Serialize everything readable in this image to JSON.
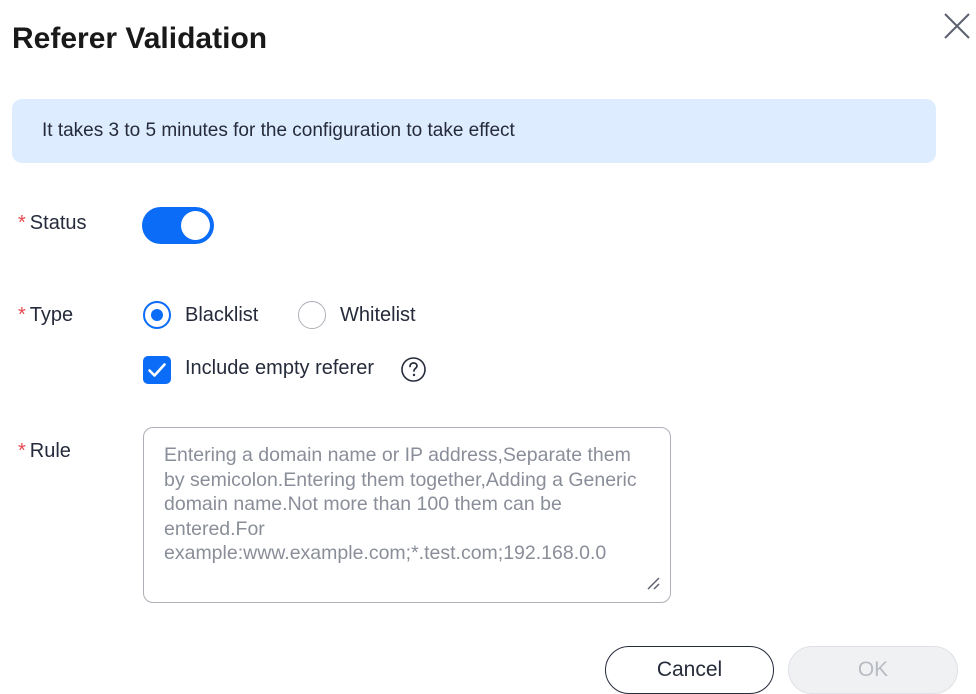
{
  "dialog": {
    "title": "Referer Validation",
    "close_icon": "close-icon"
  },
  "notice": {
    "text": "It takes 3 to 5 minutes for the configuration to take effect"
  },
  "form": {
    "required_mark": "*",
    "status": {
      "label": "Status",
      "enabled": true
    },
    "type": {
      "label": "Type",
      "options": [
        {
          "label": "Blacklist",
          "selected": true
        },
        {
          "label": "Whitelist",
          "selected": false
        }
      ],
      "include_empty_referer": {
        "label": "Include empty referer",
        "checked": true,
        "help_icon": "question-circle-icon"
      }
    },
    "rule": {
      "label": "Rule",
      "value": "",
      "placeholder": "Entering a domain name or IP address,Separate them by semicolon.Entering them together,Adding a Generic domain name.Not more than 100 them can be entered.For example:www.example.com;*.test.com;192.168.0.0"
    }
  },
  "footer": {
    "cancel_label": "Cancel",
    "ok_label": "OK"
  },
  "colors": {
    "accent": "#0a6cf7",
    "notice_bg": "#ddecff",
    "required": "#e5484d",
    "disabled_text": "#b8bbc2"
  }
}
